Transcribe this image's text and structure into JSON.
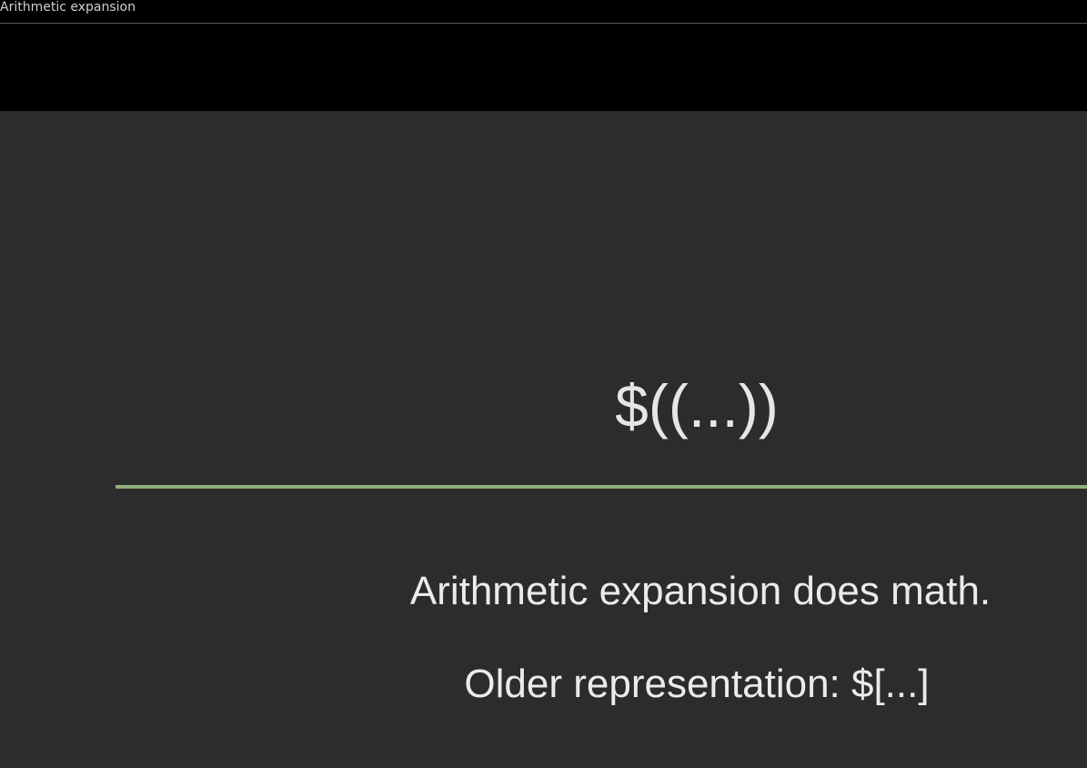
{
  "window": {
    "title": "Arithmetic expansion"
  },
  "slide": {
    "heading": "$((...))",
    "lines": [
      "Arithmetic expansion does math.",
      "Older representation: $[...]"
    ]
  },
  "colors": {
    "slide_background": "#2c2c2c",
    "divider": "#8fae7a",
    "text": "#ebebeb"
  }
}
